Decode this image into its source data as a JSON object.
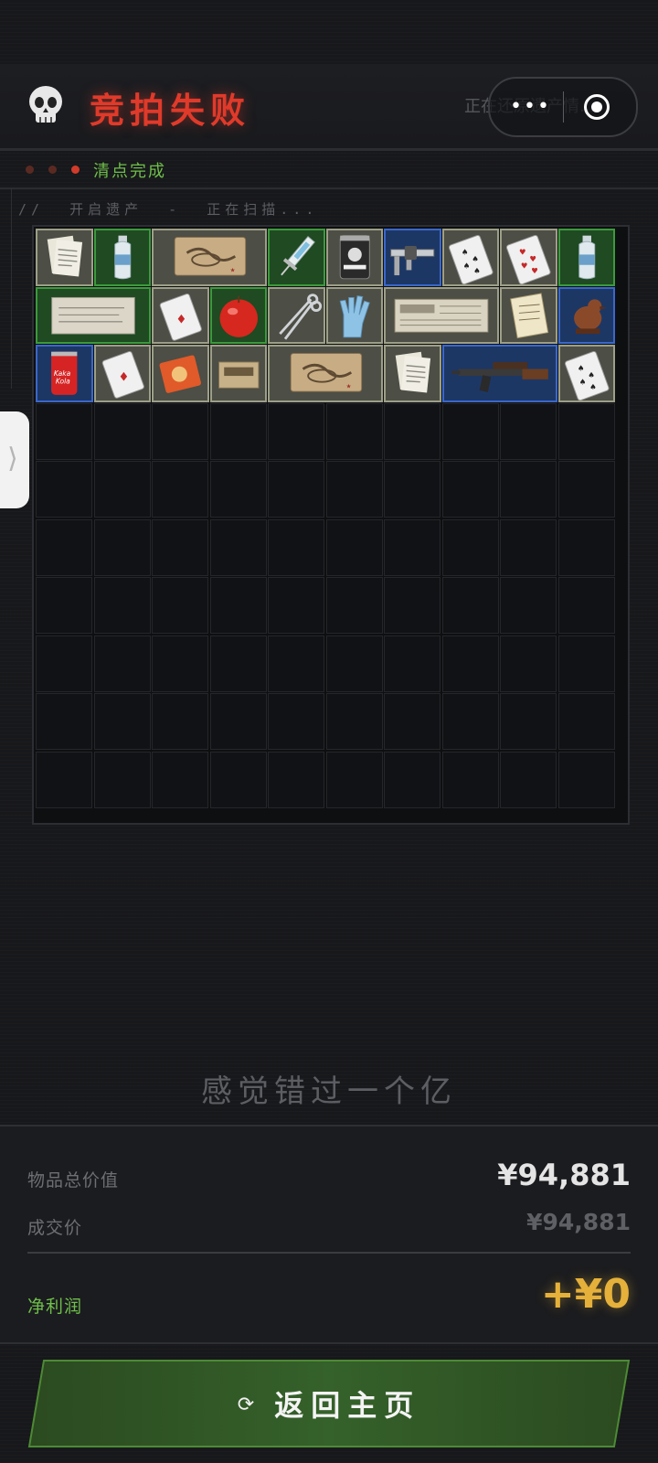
{
  "header": {
    "title": "竞拍失败",
    "restoring_text": "正在还原遗产情...",
    "capsule_more": "•••"
  },
  "status": {
    "label": "清点完成"
  },
  "scan_text": "//  开启遗产  -  正在扫描...",
  "side_tab": {
    "glyph": "⟩"
  },
  "inventory": {
    "columns": 10,
    "rows": 10,
    "items": [
      {
        "name": "documents",
        "rarity": "grey"
      },
      {
        "name": "water-bottle",
        "rarity": "green"
      },
      {
        "name": "old-map",
        "rarity": "grey"
      },
      {
        "name": "syringe",
        "rarity": "green"
      },
      {
        "name": "protein-can",
        "rarity": "grey"
      },
      {
        "name": "caliper",
        "rarity": "blue"
      },
      {
        "name": "spade-card",
        "rarity": "grey"
      },
      {
        "name": "heart-card",
        "rarity": "grey"
      },
      {
        "name": "water-bottle",
        "rarity": "green"
      },
      {
        "name": "old-letter",
        "rarity": "green"
      },
      {
        "name": "diamond-card",
        "rarity": "grey"
      },
      {
        "name": "apple",
        "rarity": "green"
      },
      {
        "name": "scissors",
        "rarity": "grey"
      },
      {
        "name": "glove",
        "rarity": "grey"
      },
      {
        "name": "newspaper",
        "rarity": "grey"
      },
      {
        "name": "notes",
        "rarity": "grey"
      },
      {
        "name": "bird-figurine",
        "rarity": "blue"
      },
      {
        "name": "soda-can",
        "rarity": "blue",
        "text": "Kaka Kola"
      },
      {
        "name": "diamond-card",
        "rarity": "grey"
      },
      {
        "name": "noodle-pack",
        "rarity": "grey"
      },
      {
        "name": "ammo-box",
        "rarity": "grey"
      },
      {
        "name": "old-map",
        "rarity": "grey"
      },
      {
        "name": "documents",
        "rarity": "grey"
      },
      {
        "name": "rifle",
        "rarity": "blue"
      },
      {
        "name": "spade-card",
        "rarity": "grey"
      }
    ]
  },
  "caption": "感觉错过一个亿",
  "summary": {
    "total_label": "物品总价值",
    "total_value": "¥94,881",
    "deal_label": "成交价",
    "deal_value": "¥94,881",
    "profit_label": "净利润",
    "profit_value": "+¥0"
  },
  "return_button": {
    "icon": "⟳",
    "label": "返回主页"
  },
  "colors": {
    "title_red": "#e03a2a",
    "status_green": "#6fbf4a",
    "profit_gold": "#e5b13a",
    "button_green": "#2f5a22"
  }
}
